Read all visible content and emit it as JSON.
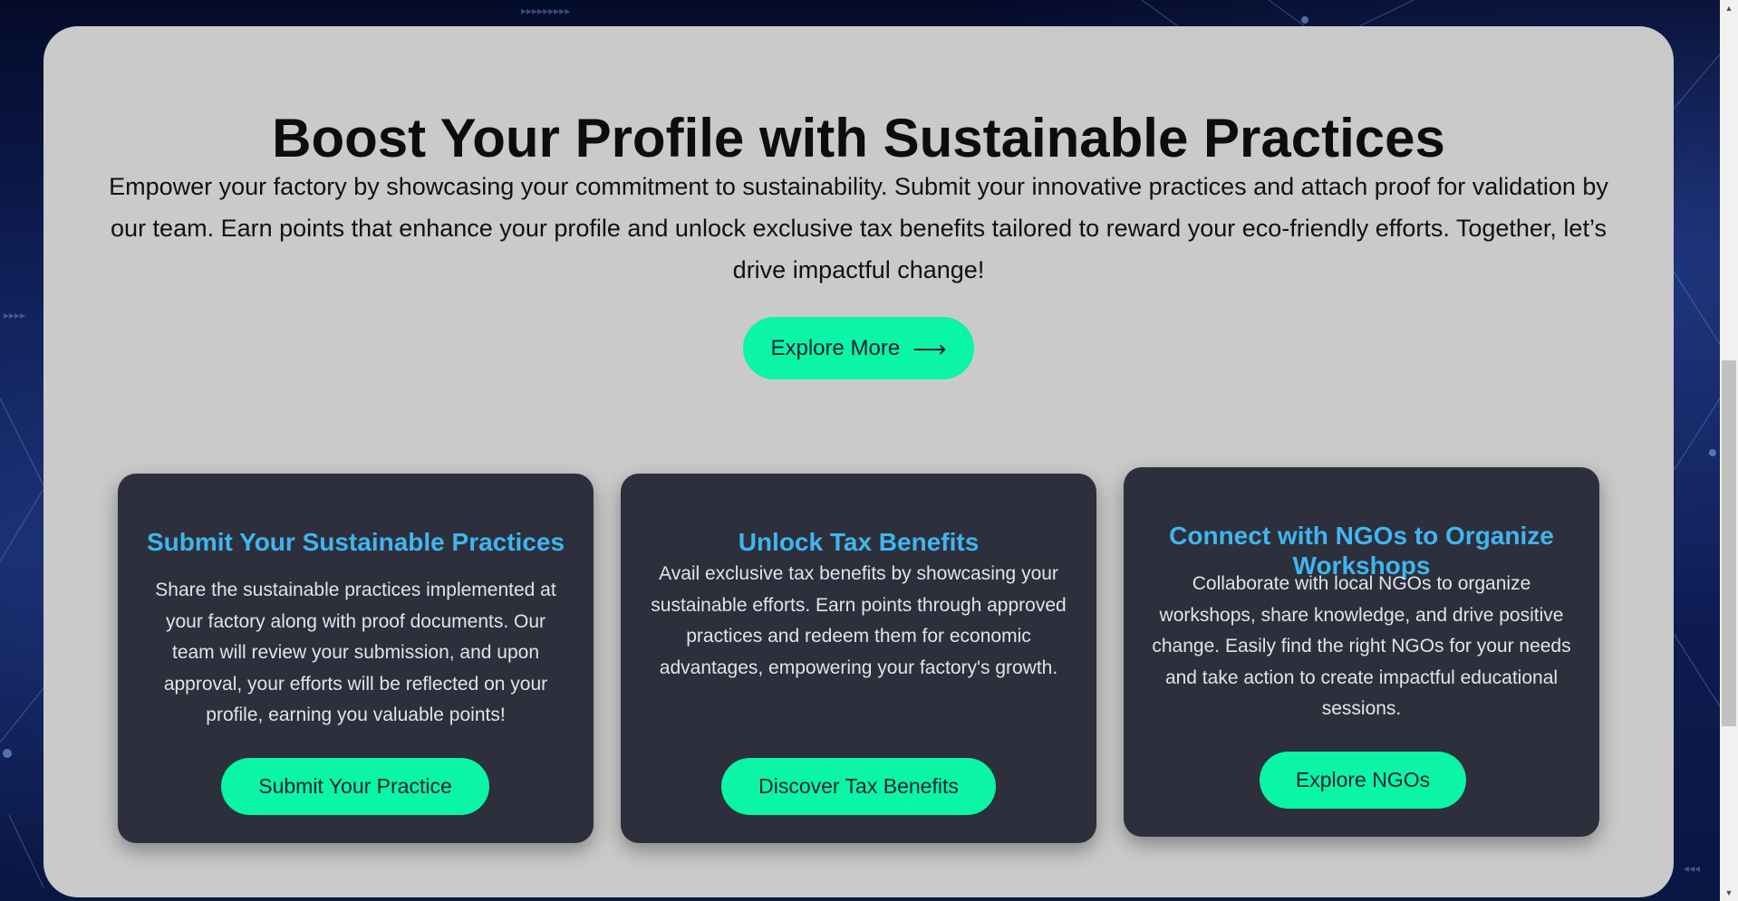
{
  "hero": {
    "title": "Boost Your Profile with Sustainable Practices",
    "description": "Empower your factory by showcasing your commitment to sustainability. Submit your innovative practices and attach proof for validation by our team. Earn points that enhance your profile and unlock exclusive tax benefits tailored to reward your eco-friendly efforts. Together, let’s drive impactful change!",
    "button_label": "Explore More",
    "button_arrow": "⟶"
  },
  "cards": [
    {
      "title": "Submit Your Sustainable Practices",
      "text": "Share the sustainable practices implemented at your factory along with proof documents. Our team will review your submission, and upon approval, your efforts will be reflected on your profile, earning you valuable points!",
      "button_label": "Submit Your Practice"
    },
    {
      "title": "Unlock Tax Benefits",
      "text": "Avail exclusive tax benefits by showcasing your sustainable efforts. Earn points through approved practices and redeem them for economic advantages, empowering your factory's growth.",
      "button_label": "Discover Tax Benefits"
    },
    {
      "title": "Connect with NGOs to Organize Workshops",
      "text": "Collaborate with local NGOs to organize workshops, share knowledge, and drive positive change. Easily find the right NGOs for your needs and take action to create impactful educational sessions.",
      "button_label": "Explore NGOs"
    }
  ],
  "colors": {
    "accent": "#0af5a6",
    "card_background": "#2d2f3c",
    "card_title": "#3fb6ee",
    "panel_background": "#cacaca",
    "page_background": "#0b1640"
  },
  "scrollbar": {
    "up_icon": "scroll-up-arrow-icon",
    "down_icon": "scroll-down-arrow-icon"
  }
}
